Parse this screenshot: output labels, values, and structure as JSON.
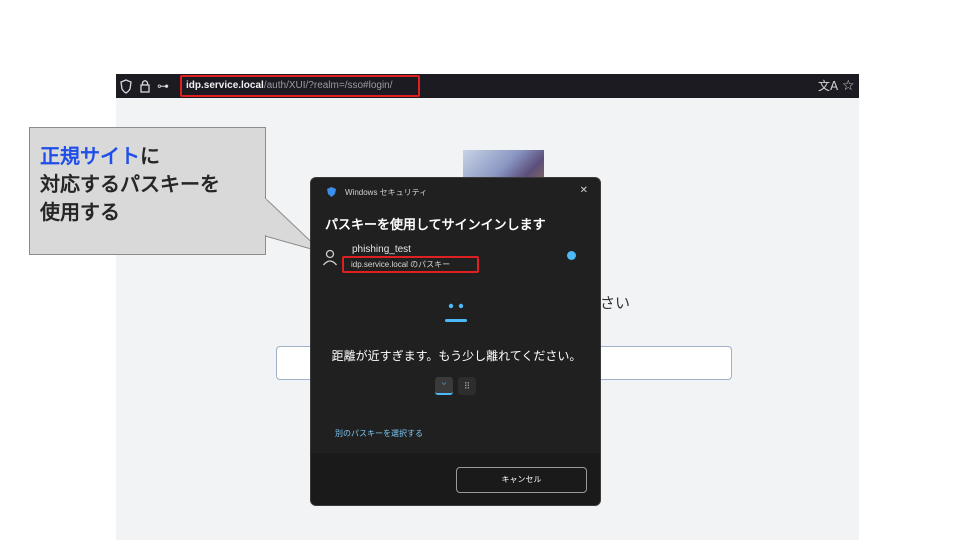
{
  "browser": {
    "url_host": "idp.service.local",
    "url_path": "/auth/XUI/?realm=/sso#login/",
    "shield_glyph": "⬡",
    "lock_glyph": "🔒",
    "key_glyph": "⊶",
    "translate_glyph": "文A",
    "star_glyph": "☆"
  },
  "page": {
    "hint_text": "さい"
  },
  "callout": {
    "highlight": "正規サイト",
    "line1_rest": "に",
    "line2": "対応するパスキーを",
    "line3": "使用する"
  },
  "dialog": {
    "app_name": "Windows セキュリティ",
    "close_glyph": "✕",
    "title": "パスキーを使用してサインインします",
    "account": "phishing_test",
    "passkey_label": "idp.service.local のパスキー",
    "message": "距離が近すぎます。もう少し離れてください。",
    "method_face_glyph": "ᵕ",
    "method_pin_glyph": "⠿",
    "alt_link": "別のパスキーを選択する",
    "cancel": "キャンセル"
  },
  "colors": {
    "accent_blue": "#4cb8f5",
    "highlight_red": "#e02020",
    "callout_highlight": "#1f4ee8"
  }
}
